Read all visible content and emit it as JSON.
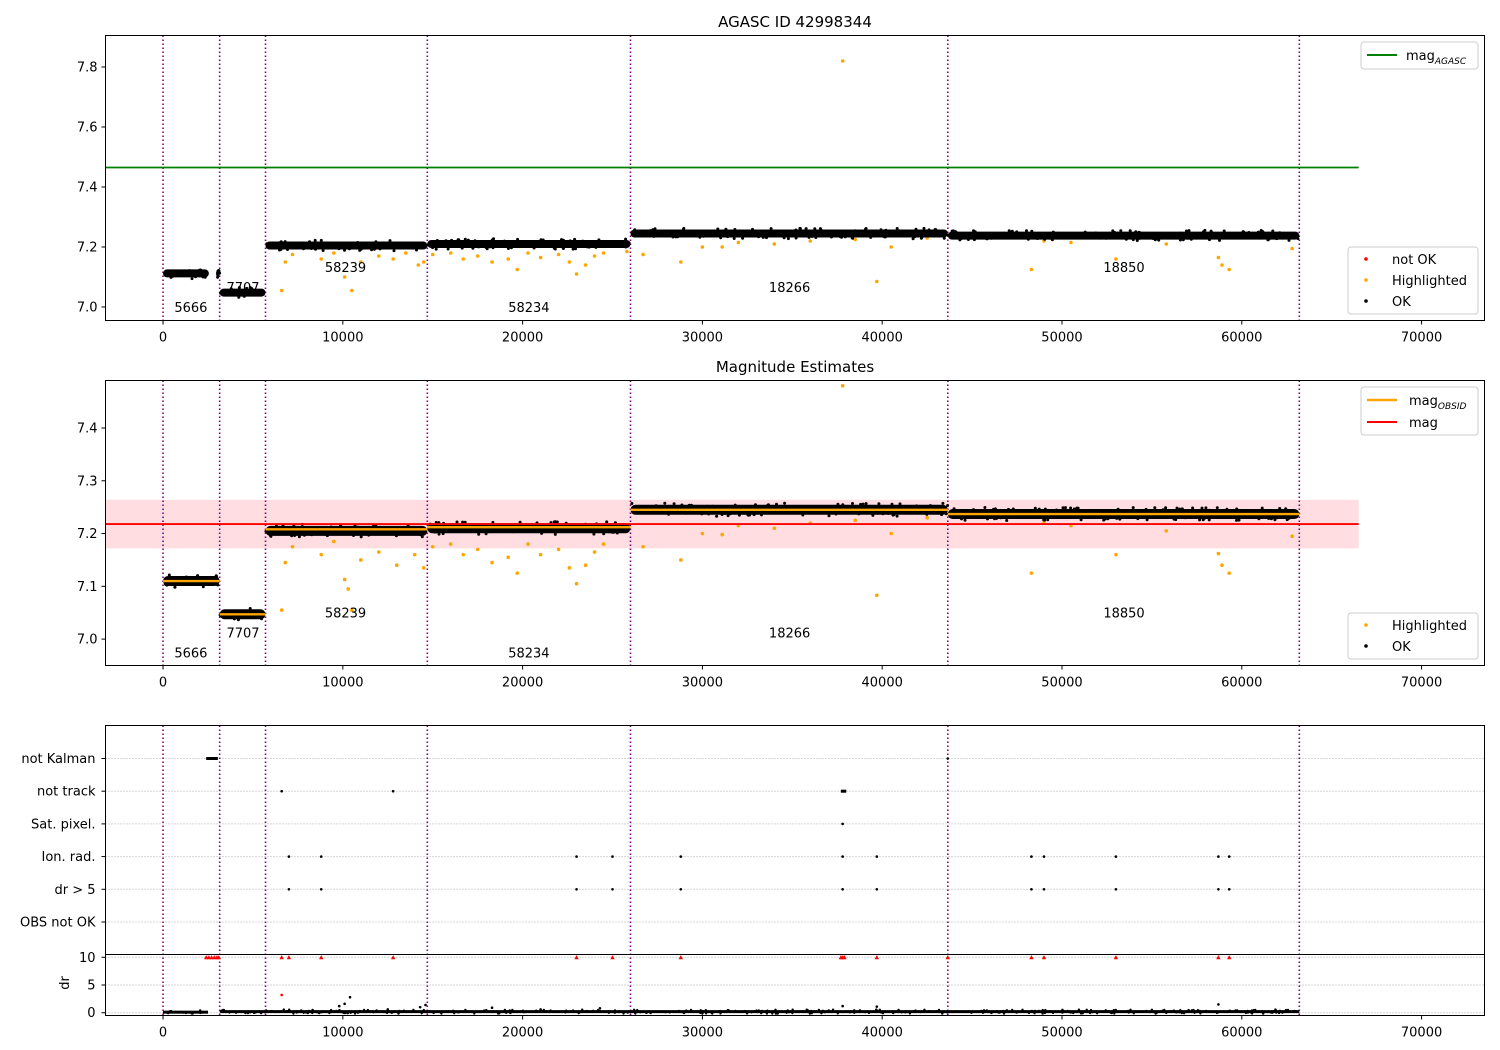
{
  "chart_data": [
    {
      "type": "scatter",
      "title": "AGASC ID 42998344",
      "xlabel": "",
      "ylabel": "",
      "xlim": [
        -3200,
        73500
      ],
      "ylim": [
        6.955,
        7.905
      ],
      "x_ticks": [
        0,
        10000,
        20000,
        30000,
        40000,
        50000,
        60000,
        70000
      ],
      "y_ticks": [
        7.0,
        7.2,
        7.4,
        7.6,
        7.8
      ],
      "obsid_boundaries": [
        0,
        3150,
        5700,
        14700,
        26000,
        43650,
        63200
      ],
      "obsid_labels": [
        {
          "text": "5666",
          "x": 1550,
          "y": 7.0
        },
        {
          "text": "7707",
          "x": 4450,
          "y": 7.067
        },
        {
          "text": "58239",
          "x": 10150,
          "y": 7.133
        },
        {
          "text": "58234",
          "x": 20350,
          "y": 7.0
        },
        {
          "text": "18266",
          "x": 34850,
          "y": 7.067
        },
        {
          "text": "18850",
          "x": 53450,
          "y": 7.133
        }
      ],
      "ok_segments": [
        {
          "x": [
            0,
            2550
          ],
          "y": 7.112
        },
        {
          "x": [
            2950,
            3150
          ],
          "y": 7.112
        },
        {
          "x": [
            3150,
            5700
          ],
          "y": 7.048
        },
        {
          "x": [
            5700,
            14700
          ],
          "y": 7.205
        },
        {
          "x": [
            14700,
            26000
          ],
          "y": 7.21
        },
        {
          "x": [
            26000,
            43650
          ],
          "y": 7.245
        },
        {
          "x": [
            43650,
            63200
          ],
          "y": 7.238
        }
      ],
      "highlighted_points": [
        {
          "x": 6600,
          "y": 7.055
        },
        {
          "x": 6800,
          "y": 7.15
        },
        {
          "x": 7200,
          "y": 7.175
        },
        {
          "x": 8800,
          "y": 7.16
        },
        {
          "x": 9500,
          "y": 7.18
        },
        {
          "x": 10100,
          "y": 7.1
        },
        {
          "x": 10500,
          "y": 7.055
        },
        {
          "x": 11000,
          "y": 7.15
        },
        {
          "x": 12000,
          "y": 7.17
        },
        {
          "x": 12800,
          "y": 7.16
        },
        {
          "x": 13500,
          "y": 7.18
        },
        {
          "x": 14200,
          "y": 7.14
        },
        {
          "x": 14500,
          "y": 7.15
        },
        {
          "x": 15000,
          "y": 7.175
        },
        {
          "x": 16000,
          "y": 7.18
        },
        {
          "x": 16700,
          "y": 7.16
        },
        {
          "x": 17500,
          "y": 7.17
        },
        {
          "x": 18300,
          "y": 7.15
        },
        {
          "x": 19200,
          "y": 7.16
        },
        {
          "x": 19700,
          "y": 7.125
        },
        {
          "x": 20300,
          "y": 7.18
        },
        {
          "x": 21000,
          "y": 7.165
        },
        {
          "x": 22000,
          "y": 7.175
        },
        {
          "x": 22600,
          "y": 7.15
        },
        {
          "x": 23000,
          "y": 7.11
        },
        {
          "x": 23500,
          "y": 7.14
        },
        {
          "x": 24000,
          "y": 7.17
        },
        {
          "x": 24500,
          "y": 7.18
        },
        {
          "x": 25800,
          "y": 7.185
        },
        {
          "x": 26700,
          "y": 7.175
        },
        {
          "x": 28800,
          "y": 7.15
        },
        {
          "x": 30000,
          "y": 7.2
        },
        {
          "x": 31100,
          "y": 7.2
        },
        {
          "x": 32000,
          "y": 7.215
        },
        {
          "x": 34000,
          "y": 7.21
        },
        {
          "x": 36000,
          "y": 7.22
        },
        {
          "x": 37800,
          "y": 7.82
        },
        {
          "x": 38500,
          "y": 7.225
        },
        {
          "x": 39700,
          "y": 7.085
        },
        {
          "x": 40500,
          "y": 7.2
        },
        {
          "x": 42500,
          "y": 7.23
        },
        {
          "x": 48300,
          "y": 7.125
        },
        {
          "x": 49000,
          "y": 7.22
        },
        {
          "x": 50500,
          "y": 7.215
        },
        {
          "x": 53000,
          "y": 7.16
        },
        {
          "x": 55800,
          "y": 7.21
        },
        {
          "x": 58700,
          "y": 7.165
        },
        {
          "x": 58900,
          "y": 7.14
        },
        {
          "x": 59300,
          "y": 7.125
        },
        {
          "x": 62800,
          "y": 7.195
        }
      ],
      "mag_agasc": 7.465,
      "legend_upper": {
        "entries": [
          "mag_AGASC"
        ],
        "loc": "upper right"
      },
      "legend_lower": {
        "entries": [
          "not OK",
          "Highlighted",
          "OK"
        ],
        "loc": "lower right"
      },
      "colors": {
        "ok": "#000000",
        "highlighted": "#ffa500",
        "not_ok": "#ff0000",
        "agasc": "#008000",
        "boundary": "#800080"
      }
    },
    {
      "type": "scatter",
      "title": "Magnitude Estimates",
      "xlabel": "",
      "ylabel": "",
      "xlim": [
        -3200,
        73500
      ],
      "ylim": [
        6.95,
        7.49
      ],
      "x_ticks": [
        0,
        10000,
        20000,
        30000,
        40000,
        50000,
        60000,
        70000
      ],
      "y_ticks": [
        7.0,
        7.1,
        7.2,
        7.3,
        7.4
      ],
      "obsid_boundaries": [
        0,
        3150,
        5700,
        14700,
        26000,
        43650,
        63200
      ],
      "obsid_labels": [
        {
          "text": "5666",
          "x": 1550,
          "y": 6.975
        },
        {
          "text": "7707",
          "x": 4450,
          "y": 7.013
        },
        {
          "text": "58239",
          "x": 10150,
          "y": 7.05
        },
        {
          "text": "58234",
          "x": 20350,
          "y": 6.975
        },
        {
          "text": "18266",
          "x": 34850,
          "y": 7.013
        },
        {
          "text": "18850",
          "x": 53450,
          "y": 7.05
        }
      ],
      "ok_segments": [
        {
          "x": [
            0,
            3150
          ],
          "y": 7.11
        },
        {
          "x": [
            3150,
            5700
          ],
          "y": 7.047
        },
        {
          "x": [
            5700,
            14700
          ],
          "y": 7.205
        },
        {
          "x": [
            14700,
            26000
          ],
          "y": 7.21
        },
        {
          "x": [
            26000,
            43650
          ],
          "y": 7.245
        },
        {
          "x": [
            43650,
            63200
          ],
          "y": 7.237
        }
      ],
      "mag_obsid": [
        {
          "x": [
            0,
            3150
          ],
          "y": 7.11
        },
        {
          "x": [
            3150,
            5700
          ],
          "y": 7.047
        },
        {
          "x": [
            5700,
            14700
          ],
          "y": 7.208
        },
        {
          "x": [
            14700,
            26000
          ],
          "y": 7.212
        },
        {
          "x": [
            26000,
            43650
          ],
          "y": 7.245
        },
        {
          "x": [
            43650,
            63200
          ],
          "y": 7.237
        }
      ],
      "mag": 7.218,
      "mag_band": [
        7.172,
        7.264
      ],
      "highlighted_points": [
        {
          "x": 6600,
          "y": 7.055
        },
        {
          "x": 6800,
          "y": 7.145
        },
        {
          "x": 7200,
          "y": 7.175
        },
        {
          "x": 8800,
          "y": 7.16
        },
        {
          "x": 9500,
          "y": 7.185
        },
        {
          "x": 10100,
          "y": 7.113
        },
        {
          "x": 10300,
          "y": 7.095
        },
        {
          "x": 10500,
          "y": 7.055
        },
        {
          "x": 11000,
          "y": 7.15
        },
        {
          "x": 12000,
          "y": 7.165
        },
        {
          "x": 13000,
          "y": 7.14
        },
        {
          "x": 14000,
          "y": 7.16
        },
        {
          "x": 14500,
          "y": 7.135
        },
        {
          "x": 15000,
          "y": 7.175
        },
        {
          "x": 16000,
          "y": 7.18
        },
        {
          "x": 16700,
          "y": 7.16
        },
        {
          "x": 17500,
          "y": 7.17
        },
        {
          "x": 18300,
          "y": 7.145
        },
        {
          "x": 19200,
          "y": 7.155
        },
        {
          "x": 19700,
          "y": 7.125
        },
        {
          "x": 20300,
          "y": 7.18
        },
        {
          "x": 21000,
          "y": 7.16
        },
        {
          "x": 22000,
          "y": 7.17
        },
        {
          "x": 22600,
          "y": 7.135
        },
        {
          "x": 23000,
          "y": 7.105
        },
        {
          "x": 23500,
          "y": 7.14
        },
        {
          "x": 24000,
          "y": 7.165
        },
        {
          "x": 24500,
          "y": 7.18
        },
        {
          "x": 26700,
          "y": 7.175
        },
        {
          "x": 28800,
          "y": 7.15
        },
        {
          "x": 30000,
          "y": 7.2
        },
        {
          "x": 31100,
          "y": 7.198
        },
        {
          "x": 32000,
          "y": 7.215
        },
        {
          "x": 34000,
          "y": 7.21
        },
        {
          "x": 36000,
          "y": 7.22
        },
        {
          "x": 37800,
          "y": 7.48
        },
        {
          "x": 38500,
          "y": 7.225
        },
        {
          "x": 39700,
          "y": 7.083
        },
        {
          "x": 40500,
          "y": 7.2
        },
        {
          "x": 42500,
          "y": 7.23
        },
        {
          "x": 48300,
          "y": 7.125
        },
        {
          "x": 49000,
          "y": 7.22
        },
        {
          "x": 50500,
          "y": 7.215
        },
        {
          "x": 53000,
          "y": 7.16
        },
        {
          "x": 55800,
          "y": 7.205
        },
        {
          "x": 58700,
          "y": 7.162
        },
        {
          "x": 58900,
          "y": 7.14
        },
        {
          "x": 59300,
          "y": 7.125
        },
        {
          "x": 62800,
          "y": 7.195
        }
      ],
      "legend_upper": {
        "entries": [
          "mag_OBSID",
          "mag"
        ],
        "loc": "upper right"
      },
      "legend_lower": {
        "entries": [
          "Highlighted",
          "OK"
        ],
        "loc": "lower right"
      },
      "colors": {
        "ok": "#000000",
        "highlighted": "#ffa500",
        "mag_obsid": "#ffa500",
        "mag": "#ff0000",
        "band": "#ffdde0",
        "boundary": "#800080"
      }
    },
    {
      "type": "scatter",
      "title": "",
      "xlabel": "",
      "ylabel": "",
      "xlim": [
        -3200,
        73500
      ],
      "x_ticks": [
        0,
        10000,
        20000,
        30000,
        40000,
        50000,
        60000,
        70000
      ],
      "flag_rows": [
        "not Kalman",
        "not track",
        "Sat. pixel.",
        "Ion. rad.",
        "dr > 5",
        "OBS not OK"
      ],
      "flag_points": {
        "not Kalman": [
          {
            "x": [
              2400,
              3050
            ]
          },
          {
            "x": [
              43650
            ]
          }
        ],
        "not track": [
          {
            "x": [
              6600
            ]
          },
          {
            "x": [
              12800
            ]
          },
          {
            "x": [
              37700,
              38000
            ]
          }
        ],
        "Sat. pixel.": [
          {
            "x": [
              37800
            ]
          }
        ],
        "Ion. rad.": [
          {
            "x": [
              7000
            ]
          },
          {
            "x": [
              8800
            ]
          },
          {
            "x": [
              23000
            ]
          },
          {
            "x": [
              25000
            ]
          },
          {
            "x": [
              28800
            ]
          },
          {
            "x": [
              37800
            ]
          },
          {
            "x": [
              39700
            ]
          },
          {
            "x": [
              48300
            ]
          },
          {
            "x": [
              49000
            ]
          },
          {
            "x": [
              53000
            ]
          },
          {
            "x": [
              58700
            ]
          },
          {
            "x": [
              59300
            ]
          }
        ],
        "dr > 5": [
          {
            "x": [
              7000
            ]
          },
          {
            "x": [
              8800
            ]
          },
          {
            "x": [
              23000
            ]
          },
          {
            "x": [
              25000
            ]
          },
          {
            "x": [
              28800
            ]
          },
          {
            "x": [
              37800
            ]
          },
          {
            "x": [
              39700
            ]
          },
          {
            "x": [
              48300
            ]
          },
          {
            "x": [
              49000
            ]
          },
          {
            "x": [
              53000
            ]
          },
          {
            "x": [
              58700
            ]
          },
          {
            "x": [
              59300
            ]
          }
        ],
        "OBS not OK": []
      },
      "dr_panel": {
        "ylabel": "dr",
        "ylim": [
          -0.5,
          10.5
        ],
        "y_ticks": [
          0,
          5,
          10
        ],
        "ok_segments": [
          {
            "x": [
              0,
              2500
            ],
            "y": 0.1
          },
          {
            "x": [
              3200,
              63200
            ],
            "y": 0.2
          }
        ],
        "clipped_points_at_10": [
          2400,
          2550,
          2700,
          2850,
          3000,
          3100,
          6600,
          7000,
          8800,
          12800,
          23000,
          25000,
          28800,
          37700,
          37800,
          37900,
          39700,
          43650,
          48300,
          49000,
          53000,
          58700,
          59300
        ],
        "scatter_points": [
          {
            "x": 6600,
            "y": 3.2
          },
          {
            "x": 9800,
            "y": 1.2
          },
          {
            "x": 10100,
            "y": 1.6
          },
          {
            "x": 10400,
            "y": 2.8
          },
          {
            "x": 12500,
            "y": 0.6
          },
          {
            "x": 14300,
            "y": 1.0
          },
          {
            "x": 14600,
            "y": 1.4
          },
          {
            "x": 18300,
            "y": 0.9
          },
          {
            "x": 21000,
            "y": 0.6
          },
          {
            "x": 24300,
            "y": 0.8
          },
          {
            "x": 37800,
            "y": 1.2
          },
          {
            "x": 39700,
            "y": 1.1
          },
          {
            "x": 58700,
            "y": 1.5
          }
        ]
      },
      "obsid_boundaries": [
        0,
        3150,
        5700,
        14700,
        26000,
        43650,
        63200
      ],
      "colors": {
        "flag": "#000000",
        "clipped": "#ff0000",
        "ok": "#000000",
        "boundary": "#800080",
        "grid": "#b0b0b0"
      }
    }
  ]
}
